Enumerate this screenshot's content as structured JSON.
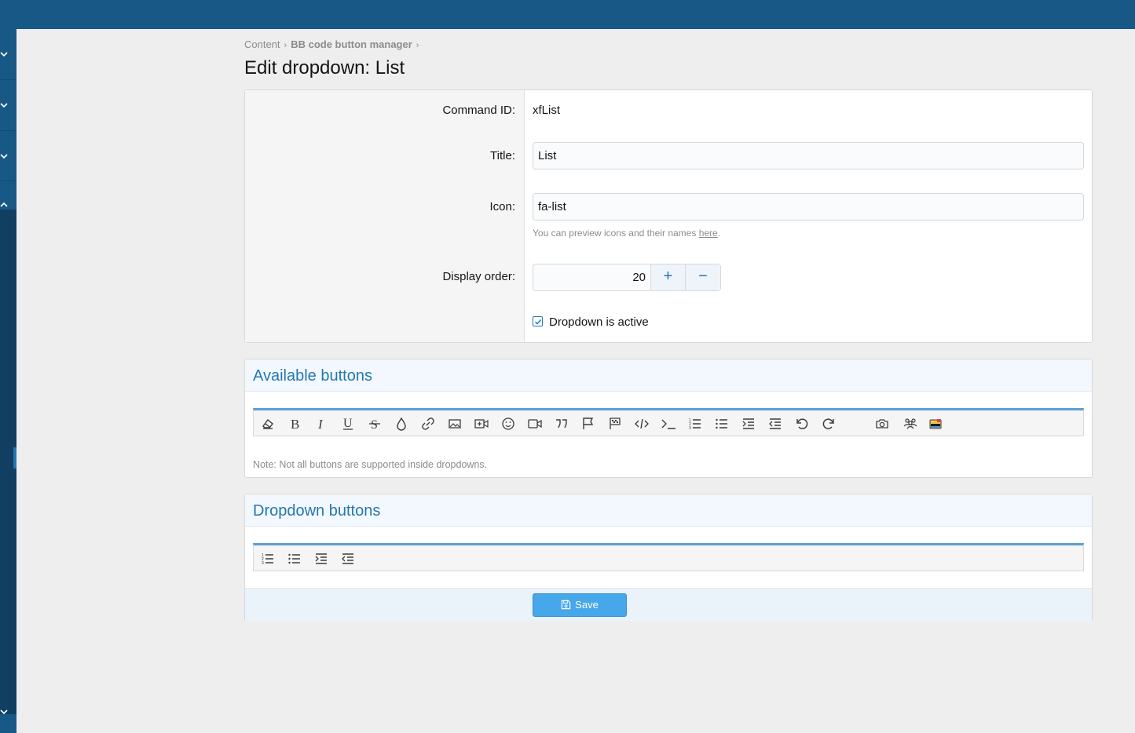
{
  "breadcrumb": {
    "item1": "Content",
    "item2": "BB code button manager",
    "separator": "›"
  },
  "page_title": "Edit dropdown: List",
  "form": {
    "command_id_label": "Command ID:",
    "command_id_value": "xfList",
    "title_label": "Title:",
    "title_value": "List",
    "icon_label": "Icon:",
    "icon_value": "fa-list",
    "icon_hint_prefix": "You can preview icons and their names ",
    "icon_hint_link": "here",
    "icon_hint_suffix": ".",
    "display_order_label": "Display order:",
    "display_order_value": "20",
    "plus_symbol": "+",
    "minus_symbol": "−",
    "active_label": "Dropdown is active",
    "active_checked": true
  },
  "available": {
    "title": "Available buttons",
    "buttons": [
      "eraser-icon",
      "bold-icon",
      "italic-icon",
      "underline-icon",
      "strikethrough-icon",
      "color-drop-icon",
      "link-icon",
      "image-icon",
      "media-icon",
      "smilie-icon",
      "video-icon",
      "quote-icon",
      "spoiler-flag-icon",
      "inline-spoiler-icon",
      "code-icon",
      "inline-code-icon",
      "ordered-list-icon",
      "unordered-list-icon",
      "indent-icon",
      "outdent-icon",
      "undo-icon",
      "redo-icon",
      "camera-icon",
      "users-icon",
      "custom-color-icon"
    ],
    "note": "Note: Not all buttons are supported inside dropdowns."
  },
  "dropdown": {
    "title": "Dropdown buttons",
    "buttons": [
      "ordered-list-icon",
      "unordered-list-icon",
      "indent-icon",
      "outdent-icon"
    ]
  },
  "save_label": "Save",
  "colors": {
    "topbar": "#185886",
    "accent": "#2577b1",
    "save_button": "#47a7eb"
  }
}
